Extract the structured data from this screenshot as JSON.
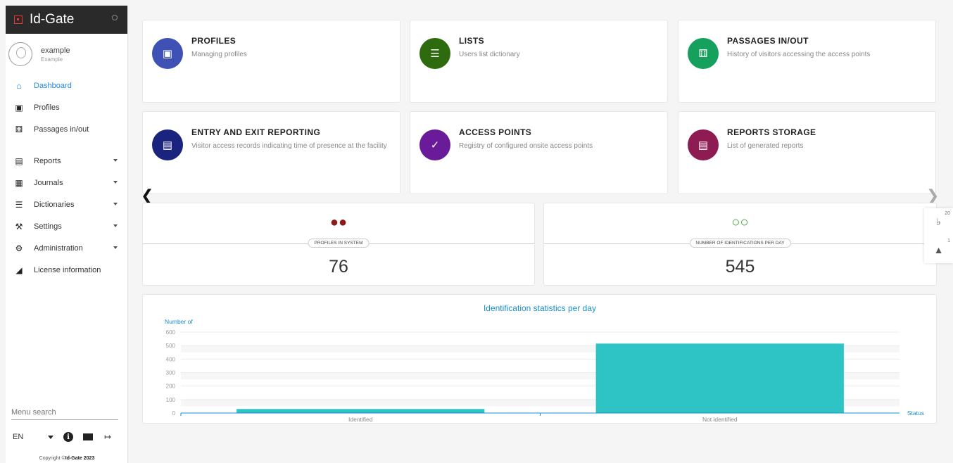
{
  "brand": {
    "title": "Id-Gate"
  },
  "user": {
    "name": "example",
    "role": "Example"
  },
  "nav": [
    {
      "label": "Dashboard",
      "icon": "home-icon",
      "active": true
    },
    {
      "label": "Profiles",
      "icon": "id-card-icon"
    },
    {
      "label": "Passages in/out",
      "icon": "running-person-icon"
    },
    {
      "label": "Reports",
      "icon": "report-icon",
      "caret": true
    },
    {
      "label": "Journals",
      "icon": "table-icon",
      "caret": true
    },
    {
      "label": "Dictionaries",
      "icon": "list-icon",
      "caret": true
    },
    {
      "label": "Settings",
      "icon": "wrench-icon",
      "caret": true
    },
    {
      "label": "Administration",
      "icon": "gear-icon",
      "caret": true
    },
    {
      "label": "License information",
      "icon": "license-icon"
    }
  ],
  "menu_search": {
    "placeholder": "Menu search"
  },
  "bottom": {
    "lang": "EN",
    "copyright_prefix": "Copyright ©",
    "copyright_brand": "Id-Gate 2023"
  },
  "tiles": [
    {
      "title": "PROFILES",
      "sub": "Managing profiles",
      "color": "#3f51b5",
      "icon": "id-card-icon"
    },
    {
      "title": "LISTS",
      "sub": "Users list dictionary",
      "color": "#2e6b0f",
      "icon": "list-icon"
    },
    {
      "title": "PASSAGES IN/OUT",
      "sub": "History of visitors accessing the access points",
      "color": "#16a05d",
      "icon": "running-person-icon"
    },
    {
      "title": "ENTRY AND EXIT REPORTING",
      "sub": "Visitor access records indicating time of presence at the facility",
      "color": "#1a237e",
      "icon": "report-list-icon"
    },
    {
      "title": "ACCESS POINTS",
      "sub": "Registry of configured onsite access points",
      "color": "#6a1b9a",
      "icon": "clipboard-check-icon"
    },
    {
      "title": "REPORTS STORAGE",
      "sub": "List of generated reports",
      "color": "#8e1b52",
      "icon": "storage-icon"
    }
  ],
  "stats": [
    {
      "label": "PROFILES IN SYSTEM",
      "value": "76",
      "color": "#8b1a1a",
      "icon": "users-filled-icon"
    },
    {
      "label": "NUMBER OF IDENTIFICATIONS PER DAY",
      "value": "545",
      "color": "#3aa335",
      "icon": "users-outline-icon"
    }
  ],
  "notifications": {
    "bell_count": "20",
    "warning_count": "1"
  },
  "chart_data": {
    "type": "bar",
    "title": "Identification statistics per day",
    "ylabel": "Number of",
    "xlabel": "Status",
    "categories": [
      "Identified",
      "Not identified"
    ],
    "values": [
      30,
      515
    ],
    "ylim": [
      0,
      600
    ],
    "yticks": [
      0,
      100,
      200,
      300,
      400,
      500,
      600
    ],
    "color": "#2ec4c6",
    "grid": true
  }
}
